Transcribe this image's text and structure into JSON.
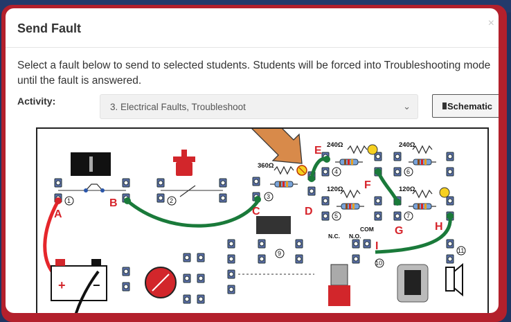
{
  "modal": {
    "title": "Send Fault",
    "close_symbol": "×",
    "description": "Select a fault below to send to selected students. Students will be forced into Troubleshooting mode until the fault is answered.",
    "activity_label": "Activity:",
    "activity_value": "3. Electrical Faults, Troubleshoot",
    "schematic_label": "Schematic"
  },
  "circuit": {
    "point_labels": [
      "A",
      "B",
      "C",
      "D",
      "E",
      "F",
      "G",
      "H",
      "I"
    ],
    "component_numbers": [
      "1",
      "2",
      "3",
      "4",
      "5",
      "6",
      "7",
      "8",
      "9",
      "10",
      "11"
    ],
    "resistor_values": [
      "360Ω",
      "240Ω",
      "240Ω",
      "120Ω",
      "120Ω"
    ],
    "switch_labels": [
      "COM",
      "N.C.",
      "N.O."
    ]
  },
  "colors": {
    "frame": "#b3202c",
    "background": "#1f3562",
    "fault_label": "#d6232a",
    "green_wire": "#1a7a3a",
    "red_wire": "#e5262b",
    "arrow": "#d88a4a"
  },
  "icons": [
    "close-icon",
    "chevron-down-icon",
    "schematic-icon",
    "arrow-pointer-icon",
    "lamp-icon",
    "resistor-icon",
    "battery-icon",
    "push-button-icon",
    "switch-icon",
    "fuse-icon",
    "buzzer-icon",
    "speaker-icon"
  ]
}
